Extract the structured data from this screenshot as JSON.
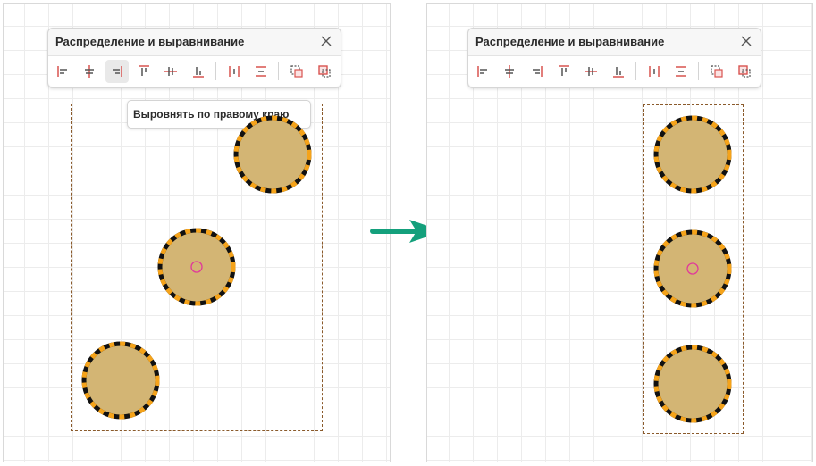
{
  "panel": {
    "title": "Распределение и выравнивание",
    "close_icon": "close-icon",
    "tools": [
      {
        "name": "align-left",
        "icon": "align-left-icon"
      },
      {
        "name": "align-center-horizontal",
        "icon": "align-center-horizontal-icon"
      },
      {
        "name": "align-right",
        "icon": "align-right-icon"
      },
      {
        "name": "align-top",
        "icon": "align-top-icon"
      },
      {
        "name": "align-center-vertical",
        "icon": "align-center-vertical-icon"
      },
      {
        "name": "align-bottom",
        "icon": "align-bottom-icon"
      },
      {
        "name": "distribute-horizontal",
        "icon": "distribute-horizontal-icon"
      },
      {
        "name": "distribute-vertical",
        "icon": "distribute-vertical-icon"
      },
      {
        "name": "align-to-selection",
        "icon": "align-to-selection-icon"
      },
      {
        "name": "align-to-key-object",
        "icon": "align-to-key-object-icon"
      }
    ]
  },
  "tooltip": {
    "text": "Выровнять по правому краю"
  },
  "colors": {
    "shape_fill": "#d3b574",
    "shape_stripe_a": "#f5a31a",
    "shape_stripe_b": "#111111",
    "center_marker": "#e0399a",
    "selection_border": "#8a5a2b",
    "arrow": "#14a07c",
    "icon_line": "#555555",
    "icon_accent": "#d9534f"
  }
}
